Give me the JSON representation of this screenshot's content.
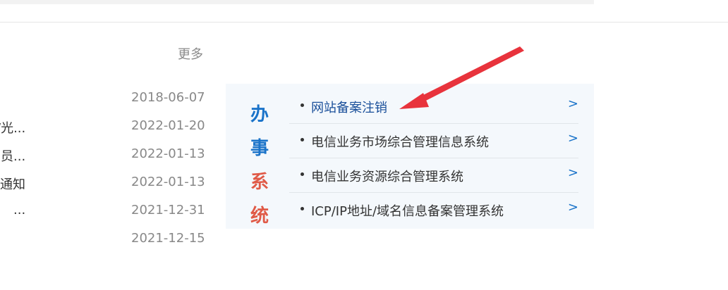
{
  "header": {
    "more_label": "更多"
  },
  "news": [
    {
      "title": "",
      "date": "2018-06-07"
    },
    {
      "title": "/光...",
      "date": "2022-01-20"
    },
    {
      "title": "员...",
      "date": "2022-01-13"
    },
    {
      "title": "通知",
      "date": "2022-01-13"
    },
    {
      "title": "...",
      "date": "2021-12-31"
    },
    {
      "title": "",
      "date": "2021-12-15"
    }
  ],
  "panel": {
    "vertical_title": [
      "办",
      "事",
      "系",
      "统"
    ],
    "items": [
      {
        "label": "网站备案注销",
        "arrow": ">"
      },
      {
        "label": "电信业务市场综合管理信息系统",
        "arrow": ">"
      },
      {
        "label": "电信业务资源综合管理系统",
        "arrow": ">"
      },
      {
        "label": "ICP/IP地址/域名信息备案管理系统",
        "arrow": ">"
      }
    ]
  },
  "colors": {
    "accent_blue": "#1a73c9",
    "accent_red": "#e05a47",
    "annotation_arrow": "#e8333c",
    "panel_bg": "#f4f8fc"
  }
}
